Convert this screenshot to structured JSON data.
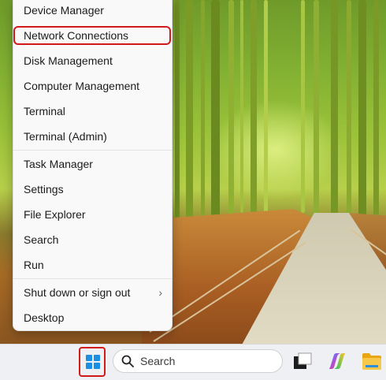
{
  "context_menu": {
    "items": [
      {
        "label": "Device Manager"
      },
      {
        "label": "Network Connections",
        "highlighted": true
      },
      {
        "label": "Disk Management"
      },
      {
        "label": "Computer Management"
      },
      {
        "label": "Terminal"
      },
      {
        "label": "Terminal (Admin)"
      },
      {
        "label": "Task Manager"
      },
      {
        "label": "Settings"
      },
      {
        "label": "File Explorer"
      },
      {
        "label": "Search"
      },
      {
        "label": "Run"
      },
      {
        "label": "Shut down or sign out",
        "submenu_arrow": "›"
      },
      {
        "label": "Desktop"
      }
    ]
  },
  "taskbar": {
    "search_placeholder": "Search",
    "icons": [
      "start-windows-icon",
      "search-icon",
      "task-view-icon",
      "copilot-icon",
      "file-explorer-icon"
    ]
  },
  "colors": {
    "highlight_border": "#d11a1a",
    "windows_blue": "#1a8fe3",
    "menu_background": "#f9f9f9",
    "taskbar_background": "#eef0f4"
  }
}
